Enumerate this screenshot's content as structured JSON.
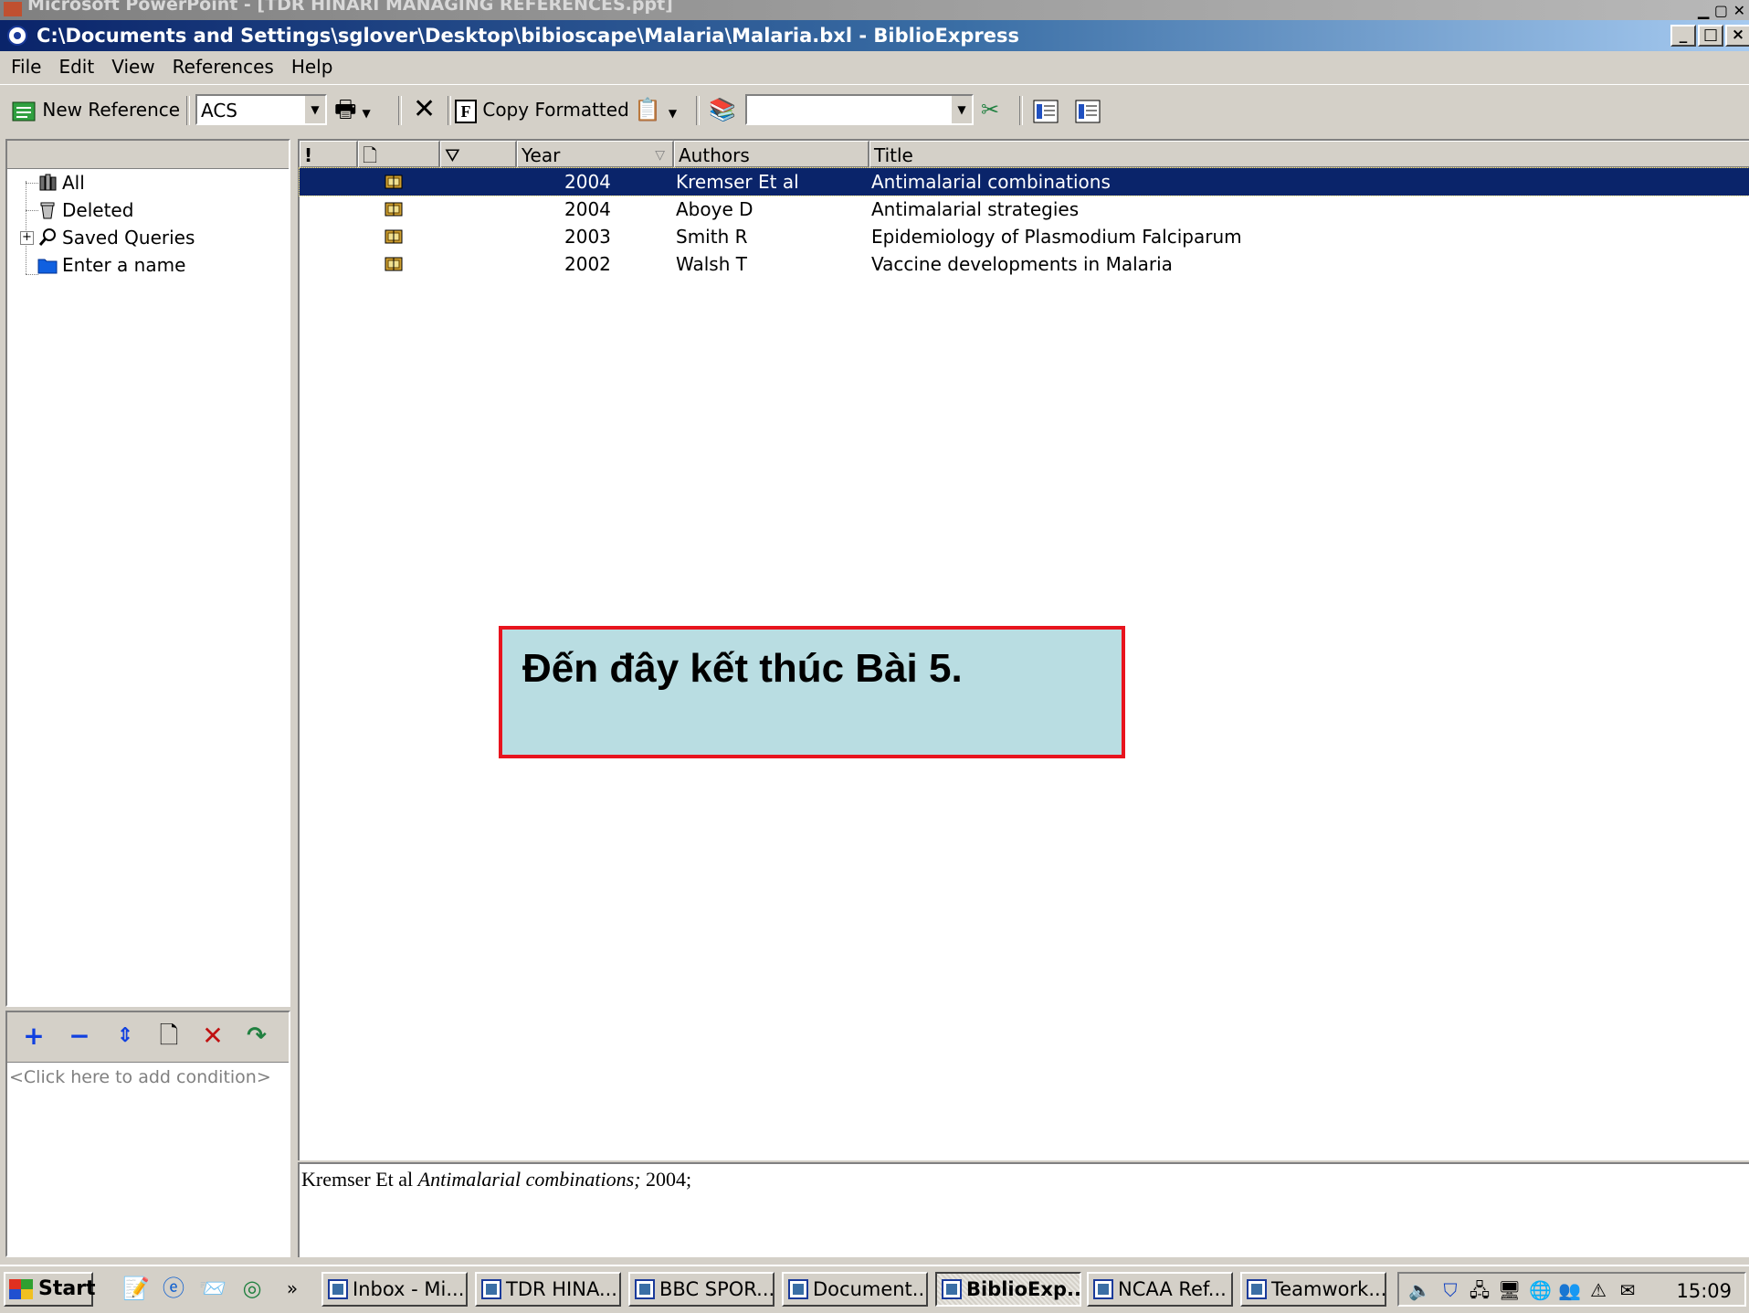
{
  "background_window": {
    "title": "Microsoft PowerPoint - [TDR HINARI MANAGING REFERENCES.ppt]"
  },
  "window": {
    "title": "C:\\Documents and Settings\\sglover\\Desktop\\bibioscape\\Malaria\\Malaria.bxl - BiblioExpress",
    "controls": {
      "minimize": "_",
      "maximize": "□",
      "close": "×"
    }
  },
  "menu": [
    "File",
    "Edit",
    "View",
    "References",
    "Help"
  ],
  "toolbar": {
    "new_reference": "New Reference",
    "style_value": "ACS",
    "copy_formatted": "Copy Formatted",
    "search_value": ""
  },
  "folders": [
    {
      "label": "All",
      "icon": "library-icon"
    },
    {
      "label": "Deleted",
      "icon": "trash-icon"
    },
    {
      "label": "Saved Queries",
      "icon": "magnifier-icon"
    },
    {
      "label": "Enter a name",
      "icon": "folder-icon"
    }
  ],
  "query": {
    "hint": "<Click here to add condition>"
  },
  "columns": {
    "priority": "!",
    "type": "",
    "filter": "",
    "year": "Year",
    "authors": "Authors",
    "title": "Title"
  },
  "references": [
    {
      "year": "2004",
      "authors": "Kremser Et al",
      "title": "Antimalarial combinations",
      "selected": true
    },
    {
      "year": "2004",
      "authors": "Aboye D",
      "title": "Antimalarial strategies",
      "selected": false
    },
    {
      "year": "2003",
      "authors": "Smith R",
      "title": "Epidemiology of Plasmodium Falciparum",
      "selected": false
    },
    {
      "year": "2002",
      "authors": "Walsh T",
      "title": "Vaccine developments in Malaria",
      "selected": false
    }
  ],
  "preview": {
    "authors": "Kremser Et al",
    "title": "Antimalarial combinations;",
    "year": "2004;"
  },
  "callout": {
    "text": "Đến đây kết thúc Bài 5.",
    "border_color": "#e8141e",
    "fill_color": "#b9dde2"
  },
  "taskbar": {
    "start": "Start",
    "more": "»",
    "tasks": [
      {
        "label": "Inbox - Mi...",
        "icon": "outlook-icon"
      },
      {
        "label": "TDR HINA...",
        "icon": "powerpoint-icon"
      },
      {
        "label": "BBC SPOR...",
        "icon": "ie-icon"
      },
      {
        "label": "Document...",
        "icon": "word-icon"
      },
      {
        "label": "BiblioExp...",
        "icon": "biblioexpress-icon",
        "active": true
      },
      {
        "label": "NCAA Ref...",
        "icon": "search-window-icon"
      },
      {
        "label": "Teamwork...",
        "icon": "word-icon"
      }
    ],
    "clock": "15:09"
  },
  "colors": {
    "title_bar": "#0a246a",
    "selection": "#0a246a",
    "face": "#d4d0c8"
  }
}
